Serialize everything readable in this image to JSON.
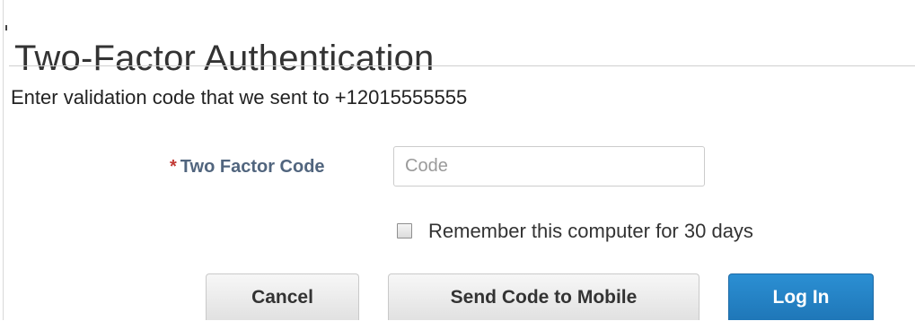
{
  "page": {
    "title": "Two-Factor Authentication",
    "instructions": "Enter validation code that we sent to +12015555555"
  },
  "form": {
    "code_field": {
      "required_marker": "*",
      "label": "Two Factor Code",
      "placeholder": "Code",
      "value": ""
    },
    "remember_checkbox": {
      "label": "Remember this computer for 30 days",
      "checked": false
    }
  },
  "actions": {
    "cancel_label": "Cancel",
    "send_code_label": "Send Code to Mobile",
    "login_label": "Log In"
  },
  "colors": {
    "required_marker": "#c23934",
    "field_label": "#51657e",
    "primary_button": "#2184c7",
    "default_button": "#ececec"
  }
}
